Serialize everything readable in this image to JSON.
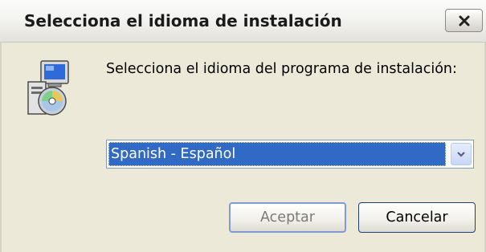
{
  "window": {
    "title": "Selecciona el idioma de instalación"
  },
  "titlebar": {
    "close_icon": "close-icon"
  },
  "dialog": {
    "icon": "setup-installer-icon",
    "prompt": "Selecciona el idioma del programa de instalación:",
    "language_select": {
      "selected": "Spanish - Español",
      "arrow_icon": "chevron-down-icon"
    }
  },
  "buttons": {
    "ok_label": "Aceptar",
    "cancel_label": "Cancelar"
  },
  "colors": {
    "selection": "#316ac5",
    "dialog_background": "#ece9d8",
    "title_text": "#1b1b1b"
  }
}
